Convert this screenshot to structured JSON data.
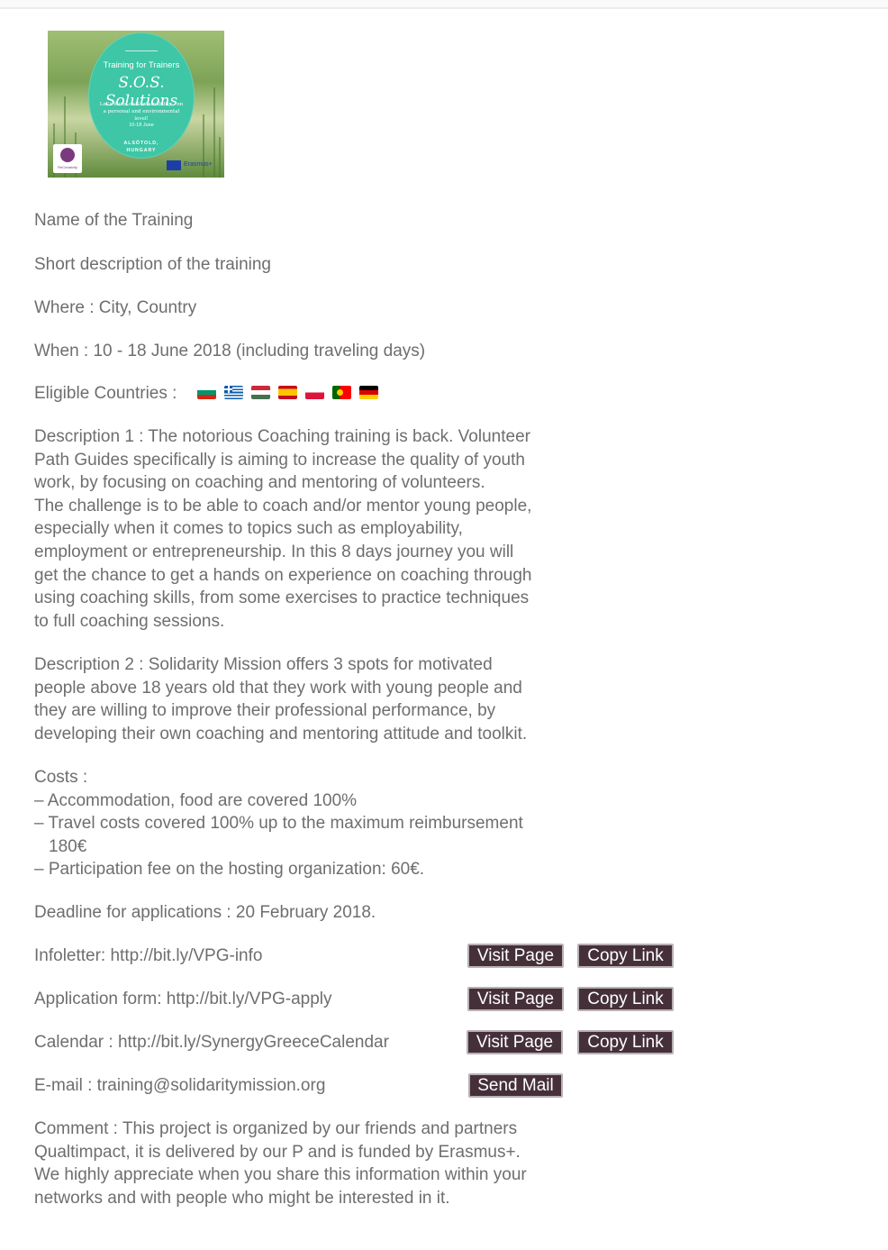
{
  "poster": {
    "subtitle": "Training for Trainers",
    "title": "S.O.S. Solutions",
    "description": "Let's focus on Sustainability - on a personal and environmental level!",
    "dates": "10-18 June",
    "place_line1": "ALSÓTOLD,",
    "place_line2": "HUNGARY",
    "org_logo_text": "ReCreativity",
    "funder": "Erasmus+"
  },
  "training": {
    "name": "Name of the Training",
    "short_description": "Short description of the training",
    "where": "Where : City, Country",
    "when": "When : 10 - 18 June 2018 (including traveling days)",
    "eligible_label": "Eligible Countries :",
    "eligible_flags": [
      "bulgaria-flag-icon",
      "greece-flag-icon",
      "hungary-flag-icon",
      "spain-flag-icon",
      "poland-flag-icon",
      "portugal-flag-icon",
      "germany-flag-icon"
    ],
    "description1_lines": [
      "Description 1 : The notorious Coaching training is back. Volunteer",
      "Path Guides specifically is aiming to increase the quality of youth",
      "work, by focusing on coaching and mentoring of volunteers.",
      "The challenge is to be able to coach and/or mentor young people,",
      "especially when it comes to topics such as employability,",
      "employment or entrepreneurship. In this 8 days journey you will",
      "get the chance to get a hands on experience on coaching through",
      "using coaching skills, from some exercises to practice techniques",
      "to full coaching sessions."
    ],
    "description2_lines": [
      "Description 2 : Solidarity Mission offers 3 spots for motivated",
      "people above 18 years old that they work with young people and",
      "they are willing to improve their professional performance, by",
      "developing their own coaching and mentoring attitude and toolkit."
    ],
    "costs_title": "Costs :",
    "costs": [
      "– Accommodation, food are covered 100%",
      "– Travel costs covered 100% up to the maximum reimbursement",
      "180€",
      "– Participation fee on the hosting organization: 60€."
    ],
    "deadline": "Deadline for applications : 20 February 2018.",
    "links": [
      {
        "text": "Infoletter: http://bit.ly/VPG-info",
        "visit": "Visit Page",
        "copy": "Copy Link"
      },
      {
        "text": "Application form: http://bit.ly/VPG-apply",
        "visit": "Visit Page",
        "copy": "Copy Link"
      },
      {
        "text": "Calendar : http://bit.ly/SynergyGreeceCalendar",
        "visit": "Visit Page",
        "copy": "Copy Link"
      }
    ],
    "email": {
      "text": "E-mail : training@solidaritymission.org",
      "button": "Send Mail"
    },
    "comment_lines": [
      "Comment : This project is organized by our friends and partners",
      "Qualtimpact, it is delivered by our P and is funded by Erasmus+.",
      "We highly appreciate when you share this information within your",
      "networks and with people who might be interested in it."
    ]
  },
  "colors": {
    "text": "#6e6e6e",
    "button_bg": "#45303a",
    "button_text": "#ffffff",
    "poster_circle": "#3ec6a6"
  }
}
